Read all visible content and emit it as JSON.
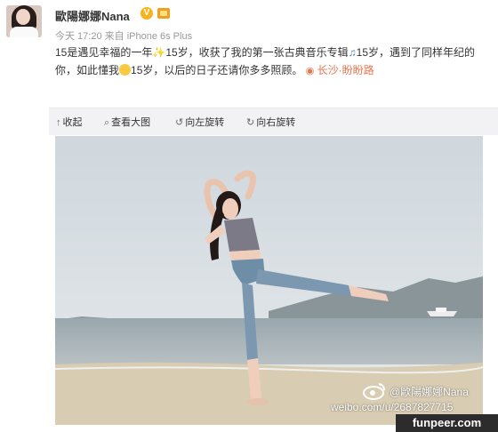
{
  "post": {
    "username": "歐陽娜娜Nana",
    "verified_badge": "V",
    "meta": "今天 17:20 来自 iPhone 6s Plus",
    "text_1": "15是遇见幸福的一年",
    "text_2": "15岁，收获了我的第一张古典音乐专辑",
    "text_3": "15岁，遇到了同样年纪的你，如此懂我",
    "text_4": "15岁，以后的日子还请你多多照顾。",
    "location": "长沙·盼盼路",
    "icons": [
      "sparkle-icon",
      "music-note-icon",
      "blowing-kiss-emoji",
      "location-pin-icon",
      "crown-icon"
    ]
  },
  "toolbar": {
    "collapse": "收起",
    "view_large": "查看大图",
    "rotate_left": "向左旋转",
    "rotate_right": "向右旋转"
  },
  "watermark": {
    "name": "@歐陽娜娜Nana",
    "url": "weibo.com/u/2687827715",
    "site": "funpeer.com"
  }
}
